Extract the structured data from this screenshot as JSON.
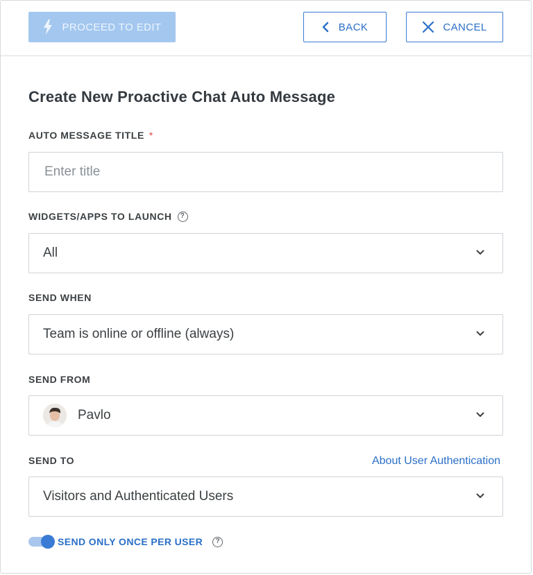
{
  "toolbar": {
    "proceed_label": "PROCEED TO EDIT",
    "back_label": "BACK",
    "cancel_label": "CANCEL"
  },
  "form": {
    "heading": "Create New Proactive Chat Auto Message",
    "title_field": {
      "label": "AUTO MESSAGE TITLE",
      "required_mark": "*",
      "value": "",
      "placeholder": "Enter title"
    },
    "widgets_field": {
      "label": "WIDGETS/APPS TO LAUNCH",
      "help": "?",
      "selected": "All"
    },
    "send_when_field": {
      "label": "SEND WHEN",
      "selected": "Team is online or offline (always)"
    },
    "send_from_field": {
      "label": "SEND FROM",
      "selected": "Pavlo"
    },
    "send_to_field": {
      "label": "SEND TO",
      "link": "About User Authentication",
      "selected": "Visitors and Authenticated Users"
    },
    "send_once_toggle": {
      "label": "SEND ONLY ONCE PER USER",
      "help": "?",
      "enabled": true
    }
  },
  "colors": {
    "accent": "#2a6fc7",
    "accent_disabled": "#a3c7ef",
    "required": "#e0463c",
    "border": "#cfd3d7"
  },
  "icons": {
    "proceed": "lightning-bolt-icon",
    "back": "chevron-left-icon",
    "cancel": "close-icon",
    "dropdown": "chevron-down-icon",
    "help": "question-circle-icon"
  }
}
